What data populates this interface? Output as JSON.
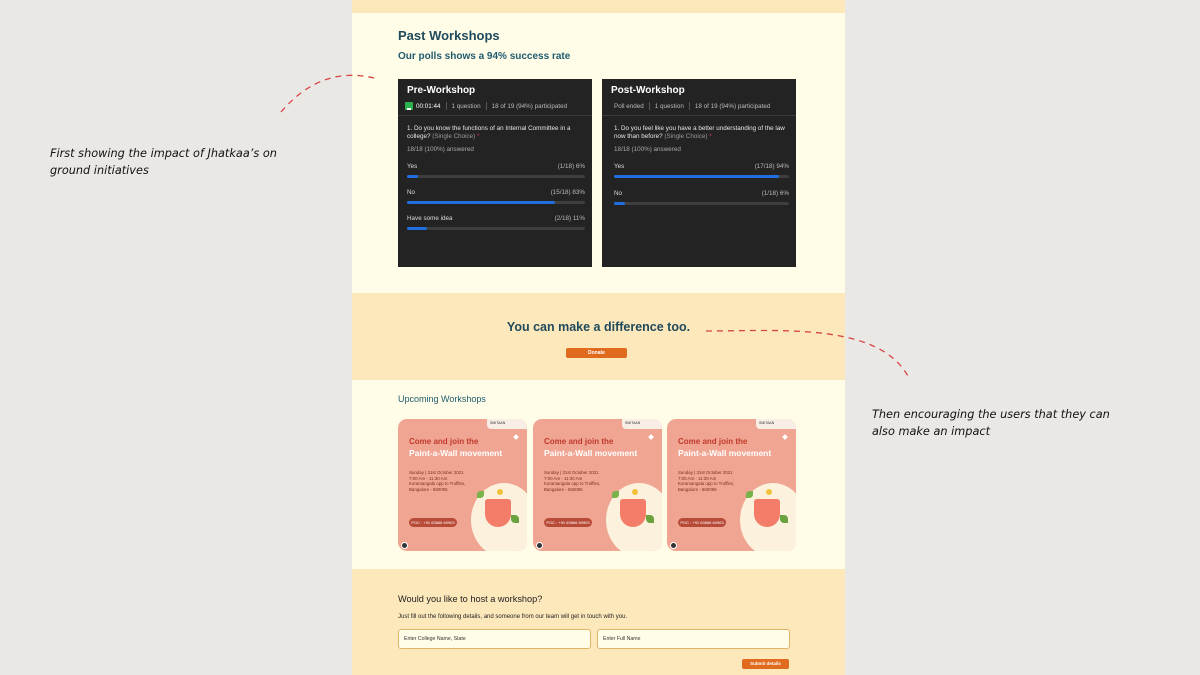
{
  "annotations": {
    "left_note": "First showing the impact of Jhatkaa’s on ground initiatives",
    "right_note": "Then encouraging the users that they can also make an impact",
    "arrow_color": "#d64545"
  },
  "past": {
    "title": "Past Workshops",
    "subtitle": "Our polls shows a 94% success rate"
  },
  "polls": [
    {
      "title": "Pre-Workshop",
      "status": "00:01:44",
      "questions": "1 question",
      "participation": "18 of 19 (94%) participated",
      "question": "1. Do you know the functions of an Internal Committee in a college?",
      "type": "(Single Choice)",
      "required": "*",
      "answered": "18/18 (100%) answered",
      "options": [
        {
          "label": "Yes",
          "result": "(1/18) 6%",
          "fraction": 0.06
        },
        {
          "label": "No",
          "result": "(15/18) 83%",
          "fraction": 0.83
        },
        {
          "label": "Have some idea",
          "result": "(2/18) 11%",
          "fraction": 0.11
        }
      ]
    },
    {
      "title": "Post-Workshop",
      "status": "Poll ended",
      "questions": "1 question",
      "participation": "18 of 19 (94%) participated",
      "question": "1. Do you feel like you have a better understanding of the law now than before?",
      "type": "(Single Choice)",
      "required": "*",
      "answered": "18/18 (100%) answered",
      "options": [
        {
          "label": "Yes",
          "result": "(17/18) 94%",
          "fraction": 0.94
        },
        {
          "label": "No",
          "result": "(1/18) 6%",
          "fraction": 0.06
        }
      ]
    }
  ],
  "cta": {
    "text": "You can make a difference too.",
    "button": "Donate"
  },
  "upcoming": {
    "title": "Upcoming Workshops",
    "card": {
      "brand": "SMITAAN",
      "line1": "Come and join the",
      "line2": "Paint-a-Wall movement",
      "date": "Sunday | 31st October 2021",
      "time": "7:00 Am - 11:30 Am",
      "place": "Koramangala opp to Truffles,",
      "city": "Bangalore - 560095",
      "poc": "POC : +91 63666 60903"
    }
  },
  "host": {
    "title": "Would you like to host a workshop?",
    "subtitle": "Just fill out the following details, and someone from our team will get in touch with you.",
    "college_placeholder": "Enter College Name, State",
    "name_placeholder": "Enter Full Name",
    "submit": "Submit details"
  },
  "colors": {
    "navy": "#1f4a5c",
    "orange": "#e06b1f",
    "band": "#fde8bb",
    "bar": "#1f6fe0"
  }
}
